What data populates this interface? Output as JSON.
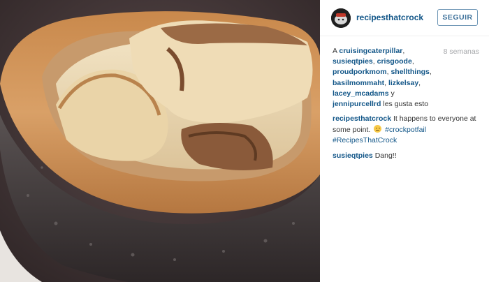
{
  "post": {
    "photo_subject": "crockpot-cake-photo",
    "username": "recipesthatcrock",
    "follow_label": "SEGUIR",
    "age": "8 semanas"
  },
  "likes": {
    "prefix": "A",
    "users": [
      "cruisingcaterpillar",
      "susieqtpies",
      "crisgoode",
      "proudporkmom",
      "shellthings",
      "basilmommaht",
      "lizkelsay",
      "lacey_mcadams",
      "jennipurcellrd"
    ],
    "sep": ",",
    "and": "y",
    "suffix": "les gusta esto"
  },
  "comments": [
    {
      "user": "recipesthatcrock",
      "text": "It happens to everyone at some point.",
      "emoji": "worried-face-icon",
      "tags": [
        "#crockpotfail",
        "#RecipesThatCrock"
      ]
    },
    {
      "user": "susieqtpies",
      "text": "Dang!!"
    }
  ],
  "colors": {
    "link": "#125688",
    "follow_border": "#6f97b6",
    "muted": "#a5a7aa"
  }
}
